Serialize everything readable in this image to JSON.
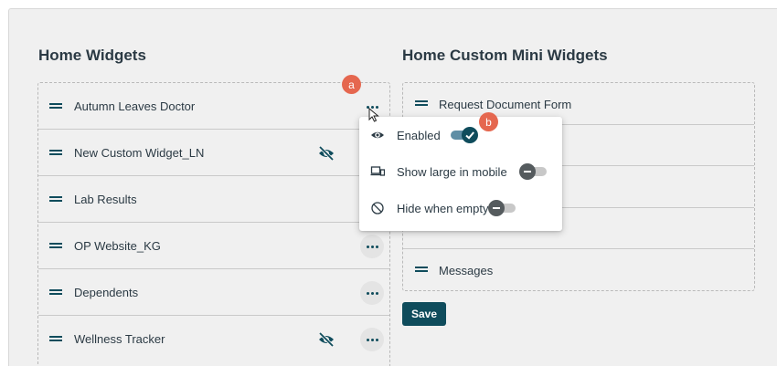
{
  "home_widgets": {
    "title": "Home Widgets",
    "items": [
      {
        "label": "Autumn Leaves Doctor"
      },
      {
        "label": "New Custom Widget_LN"
      },
      {
        "label": "Lab Results"
      },
      {
        "label": "OP Website_KG"
      },
      {
        "label": "Dependents"
      },
      {
        "label": "Wellness Tracker"
      }
    ]
  },
  "mini_widgets": {
    "title": "Home Custom Mini Widgets",
    "items": [
      {
        "label": "Request Document Form"
      },
      {
        "label": ""
      },
      {
        "label": ""
      },
      {
        "label": ""
      },
      {
        "label": "Messages"
      }
    ]
  },
  "save_label": "Save",
  "menu": {
    "items": [
      {
        "label": "Enabled",
        "icon": "eye-icon",
        "enabled": true
      },
      {
        "label": "Show large in mobile",
        "icon": "devices-icon",
        "enabled": false
      },
      {
        "label": "Hide when empty",
        "icon": "hide-empty-icon",
        "enabled": false
      }
    ]
  },
  "annotations": {
    "a": "a",
    "b": "b"
  },
  "colors": {
    "primary": "#0f4c5c",
    "badge": "#e5674f",
    "toggle_track_on": "#5f8ea5"
  }
}
